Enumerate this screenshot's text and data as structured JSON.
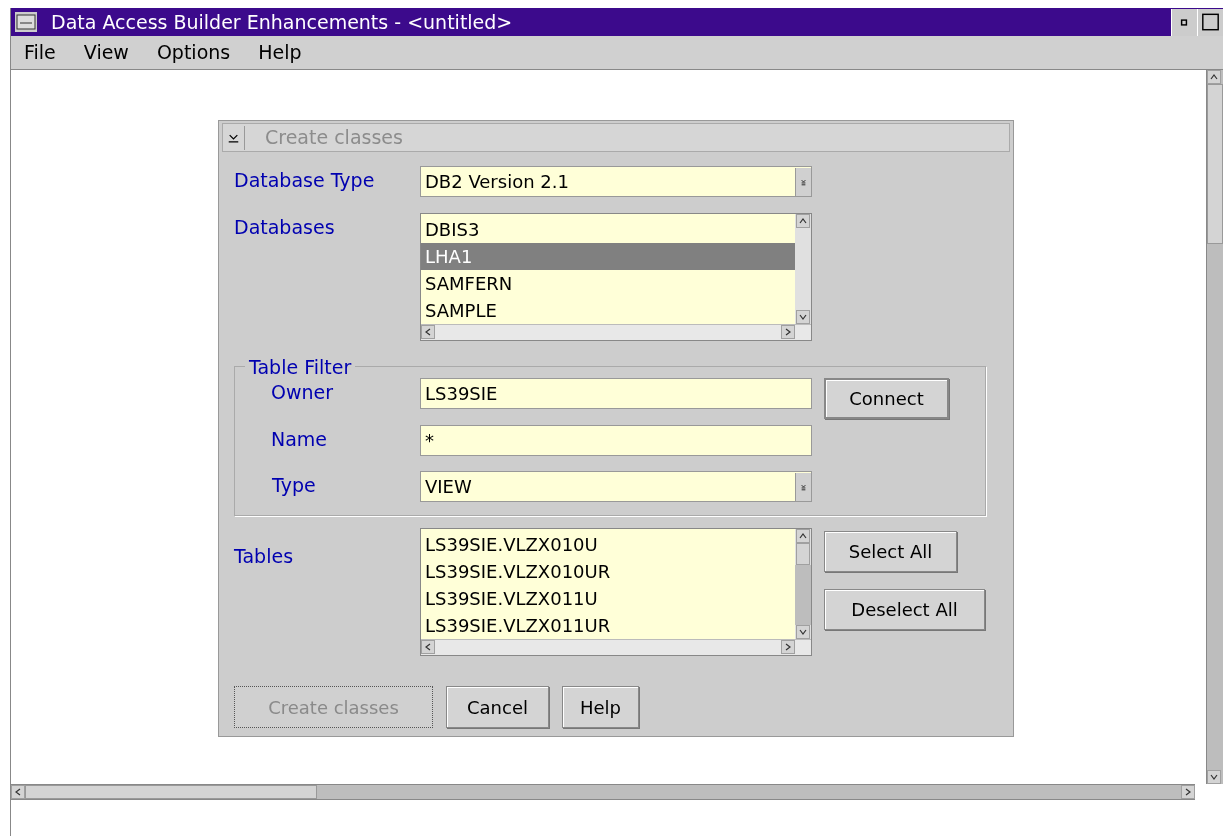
{
  "window": {
    "title": "Data Access Builder Enhancements - <untitled>"
  },
  "menu": [
    {
      "label": "File"
    },
    {
      "label": "View"
    },
    {
      "label": "Options"
    },
    {
      "label": "Help"
    }
  ],
  "dialog": {
    "title": "Create classes",
    "database_type": {
      "label": "Database Type",
      "value": "DB2 Version 2.1"
    },
    "databases": {
      "label": "Databases",
      "items": [
        {
          "text": "DBIS3",
          "selected": false
        },
        {
          "text": "LHA1",
          "selected": true
        },
        {
          "text": "SAMFERN",
          "selected": false
        },
        {
          "text": "SAMPLE",
          "selected": false
        }
      ]
    },
    "table_filter": {
      "title": "Table Filter",
      "owner": {
        "label": "Owner",
        "value": "LS39SIE"
      },
      "name": {
        "label": "Name",
        "value": "*"
      },
      "type": {
        "label": "Type",
        "value": "VIEW"
      }
    },
    "connect_button": {
      "label": "Connect"
    },
    "tables": {
      "label": "Tables",
      "items": [
        {
          "text": "LS39SIE.VLZX010U",
          "selected": false
        },
        {
          "text": "LS39SIE.VLZX010UR",
          "selected": false
        },
        {
          "text": "LS39SIE.VLZX011U",
          "selected": false
        },
        {
          "text": "LS39SIE.VLZX011UR",
          "selected": false
        }
      ]
    },
    "side_buttons": [
      {
        "label": "Select All"
      },
      {
        "label": "Deselect All"
      }
    ],
    "buttons": [
      {
        "label": "Create classes",
        "disabled": true
      },
      {
        "label": "Cancel",
        "disabled": false
      },
      {
        "label": "Help",
        "disabled": false
      }
    ]
  }
}
